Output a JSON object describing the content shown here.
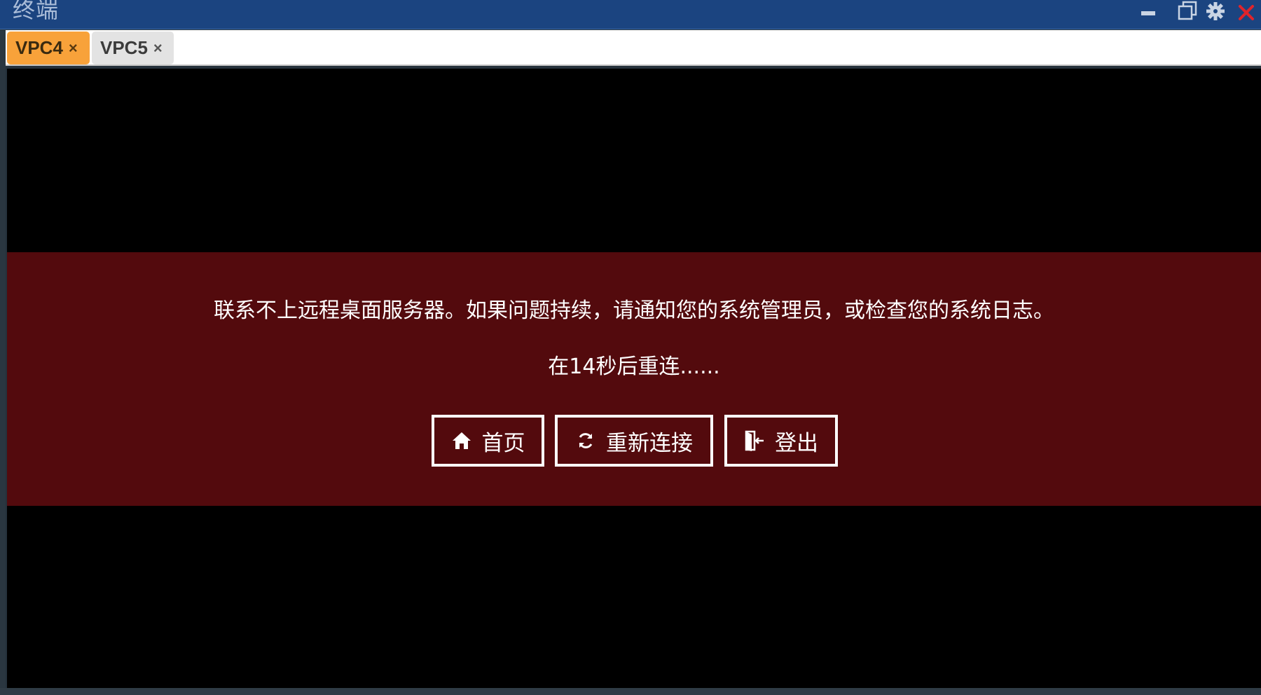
{
  "window": {
    "title": "终端"
  },
  "title_controls": {
    "minimize_icon": "minimize-icon",
    "restore_icon": "restore-icon",
    "settings_icon": "gear-icon",
    "close_icon": "close-icon",
    "close_color": "#e0242b"
  },
  "tabs": [
    {
      "label": "VPC4",
      "close": "×",
      "active": true,
      "color": "#f8a23a"
    },
    {
      "label": "VPC5",
      "close": "×",
      "active": false,
      "color": "#e3e3e3"
    }
  ],
  "error": {
    "background": "#530a0d",
    "message": "联系不上远程桌面服务器。如果问题持续，请通知您的系统管理员，或检查您的系统日志。",
    "reconnect_text": "在14秒后重连......",
    "buttons": {
      "home": {
        "label": "首页",
        "icon": "home-icon"
      },
      "reconnect": {
        "label": "重新连接",
        "icon": "refresh-icon"
      },
      "logout": {
        "label": "登出",
        "icon": "logout-icon"
      }
    }
  }
}
